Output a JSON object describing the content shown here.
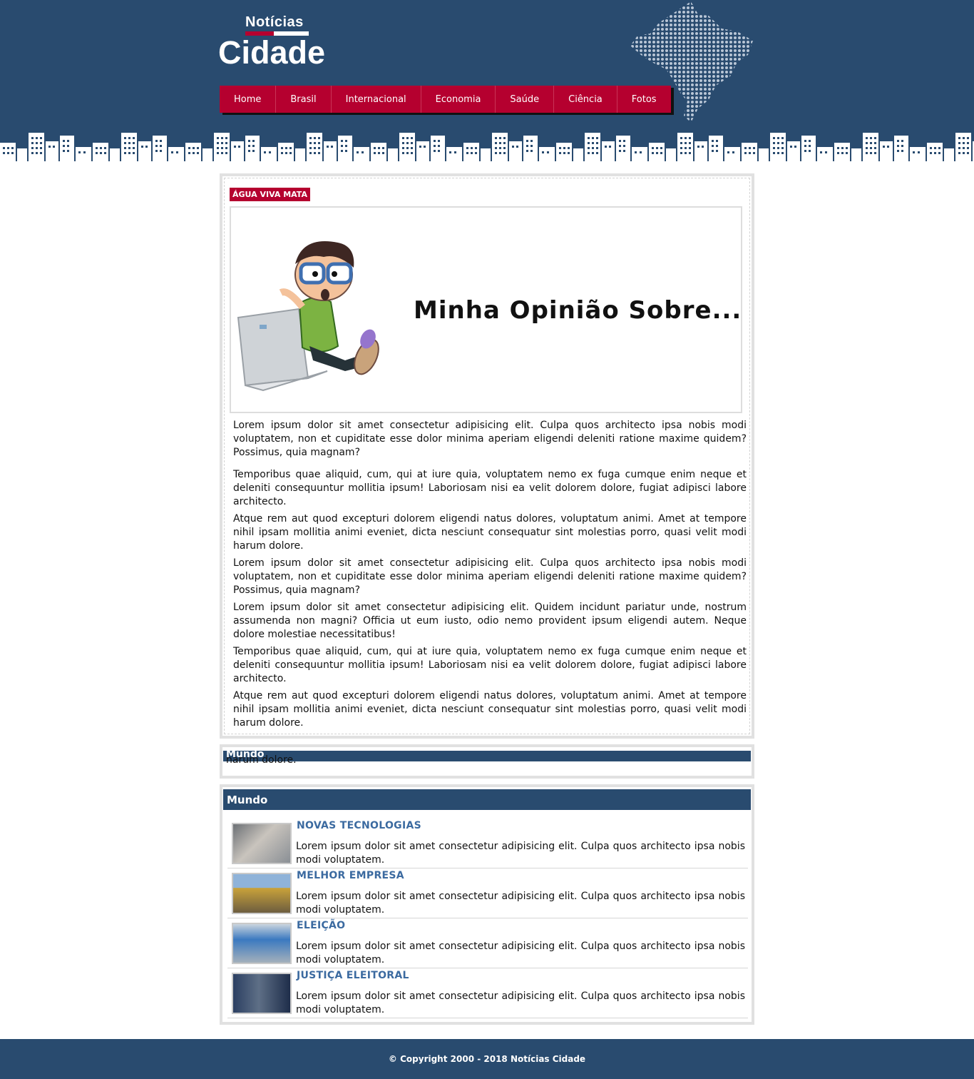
{
  "logo": {
    "small": "Notícias",
    "big": "Cidade"
  },
  "nav": [
    "Home",
    "Brasil",
    "Internacional",
    "Economia",
    "Saúde",
    "Ciência",
    "Fotos"
  ],
  "main": {
    "tag": "ÁGUA VIVA MATA",
    "banner_text": "Minha Opinião Sobre...",
    "paragraphs": [
      "Lorem ipsum dolor sit amet consectetur adipisicing elit. Culpa quos architecto ipsa nobis modi voluptatem, non et cupiditate esse dolor minima aperiam eligendi deleniti ratione maxime quidem? Possimus, quia magnam?",
      "Temporibus quae aliquid, cum, qui at iure quia, voluptatem nemo ex fuga cumque enim neque et deleniti consequuntur mollitia ipsum! Laboriosam nisi ea velit dolorem dolore, fugiat adipisci labore architecto.",
      "Atque rem aut quod excepturi dolorem eligendi natus dolores, voluptatum animi. Amet at tempore nihil ipsam mollitia animi eveniet, dicta nesciunt consequatur sint molestias porro, quasi velit modi harum dolore.",
      "Lorem ipsum dolor sit amet consectetur adipisicing elit. Culpa quos architecto ipsa nobis modi voluptatem, non et cupiditate esse dolor minima aperiam eligendi deleniti ratione maxime quidem? Possimus, quia magnam?",
      "Lorem ipsum dolor sit amet consectetur adipisicing elit. Quidem incidunt pariatur unde, nostrum assumenda non magni? Officia ut eum iusto, odio nemo provident ipsum eligendi autem. Neque dolore molestiae necessitatibus!",
      "Temporibus quae aliquid, cum, qui at iure quia, voluptatem nemo ex fuga cumque enim neque et deleniti consequuntur mollitia ipsum! Laboriosam nisi ea velit dolorem dolore, fugiat adipisci labore architecto.",
      "Atque rem aut quod excepturi dolorem eligendi natus dolores, voluptatum animi. Amet at tempore nihil ipsam mollitia animi eveniet, dicta nesciunt consequatur sint molestias porro, quasi velit modi harum dolore."
    ]
  },
  "box2": {
    "title": "Mundo",
    "overflow_text": "harum dolore."
  },
  "mundo": {
    "title": "Mundo",
    "items": [
      {
        "title": "NOVAS TECNOLOGIAS",
        "text": "Lorem ipsum dolor sit amet consectetur adipisicing elit. Culpa quos architecto ipsa nobis modi voluptatem."
      },
      {
        "title": "MELHOR EMPRESA",
        "text": "Lorem ipsum dolor sit amet consectetur adipisicing elit. Culpa quos architecto ipsa nobis modi voluptatem."
      },
      {
        "title": "ELEIÇÃO",
        "text": "Lorem ipsum dolor sit amet consectetur adipisicing elit. Culpa quos architecto ipsa nobis modi voluptatem."
      },
      {
        "title": "JUSTIÇA ELEITORAL",
        "text": "Lorem ipsum dolor sit amet consectetur adipisicing elit. Culpa quos architecto ipsa nobis modi voluptatem."
      }
    ]
  },
  "footer": {
    "copyright": "© Copyright 2000 - 2018 Notícias Cidade"
  },
  "colors": {
    "header_blue": "#294b6f",
    "accent_red": "#b5002f",
    "link_blue": "#3b6aa0"
  }
}
